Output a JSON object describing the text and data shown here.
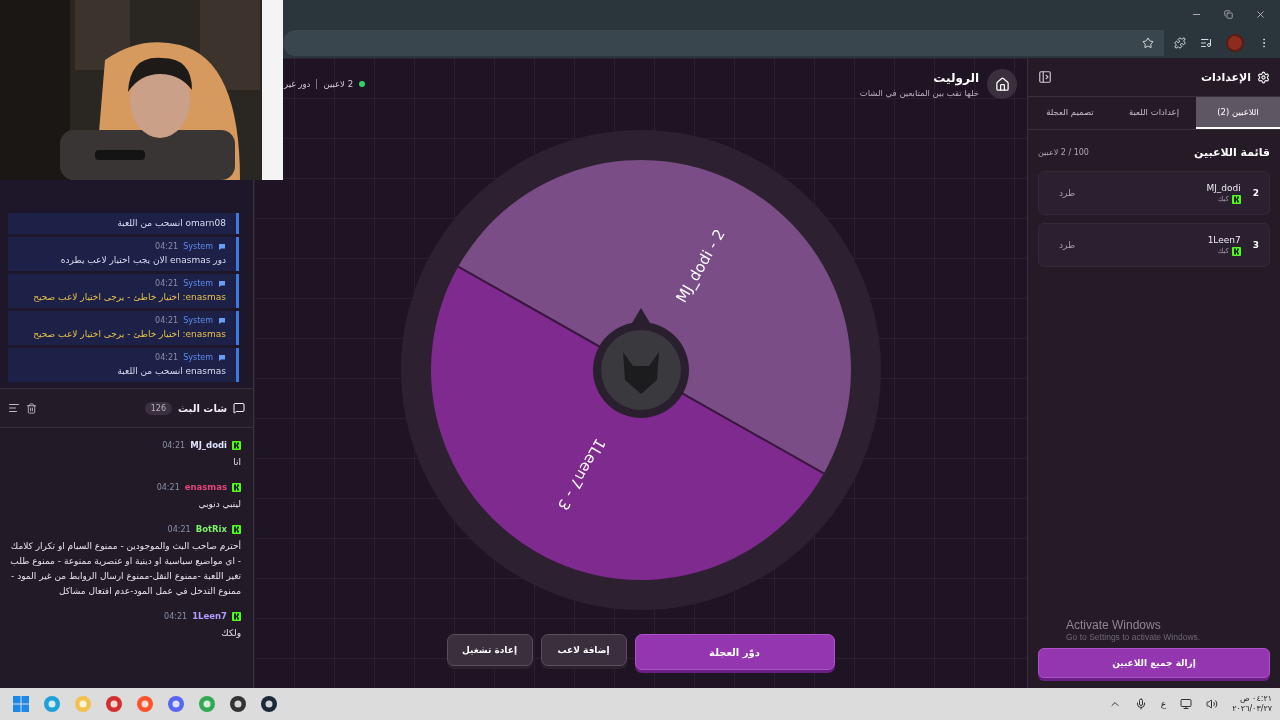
{
  "header": {
    "title": "الروليت",
    "subtitle": "خلها تقب بين المتابعين في الشات",
    "players_status": "2 لاعبين",
    "turn_status": "دور غير"
  },
  "stream_chat": {
    "system_messages": [
      {
        "text": "omarn08 انسحب من اللعبة",
        "warning": false
      },
      {
        "sender": "System",
        "time": "04:21",
        "text": "دور enasmas الان يجب اختيار لاعب يطرده",
        "warning": false
      },
      {
        "sender": "System",
        "time": "04:21",
        "text": "enasmas: اختيار خاطئ - يرجى اختيار لاعب صحيح",
        "warning": true
      },
      {
        "sender": "System",
        "time": "04:21",
        "text": "enasmas: اختيار خاطئ - يرجى اختيار لاعب صحيح",
        "warning": true
      },
      {
        "sender": "System",
        "time": "04:21",
        "text": "enasmas انسحب من اللعبة",
        "warning": false
      }
    ],
    "title": "شات البث",
    "count": "126",
    "messages": [
      {
        "user": "MJ_dodi",
        "time": "04:21",
        "text": "انا",
        "color": "#dfe3ff"
      },
      {
        "user": "enasmas",
        "time": "04:21",
        "text": "لينبي دنوبي",
        "color": "#e0457b"
      },
      {
        "user": "BotRix",
        "time": "04:21",
        "text": "أحترم صاحب البث والموجودين - ممنوع السبام او تكرار كلامك - اي مواضيع سياسية او دينية او عنصرية ممنوعة - ممنوع طلب تغير اللعبة -ممنوع النقل-ممنوع ارسال الروابط من غير المود - ممنوع التدخل في عمل المود-عدم افتعال مشاكل",
        "color": "#7cf26a"
      },
      {
        "user": "1Leen7",
        "time": "04:21",
        "text": "ولكك",
        "color": "#b49cff"
      }
    ]
  },
  "wheel": {
    "segments": [
      {
        "label": "MJ_dodi - 2",
        "color": "#7a4d86"
      },
      {
        "label": "1Leen7 - 3",
        "color": "#7e2a8e"
      }
    ]
  },
  "actions": [
    {
      "label": "دوّر العجلة",
      "kind": "primary"
    },
    {
      "label": "إضافة لاعب",
      "kind": "secondary"
    },
    {
      "label": "إعادة تشغيل",
      "kind": "secondary"
    }
  ],
  "settings": {
    "title": "الإعدادات",
    "tabs": [
      {
        "label": "اللاعبين (2)",
        "selected": true
      },
      {
        "label": "إعدادات اللعبة",
        "selected": false
      },
      {
        "label": "تصميم العجلة",
        "selected": false
      }
    ],
    "list_title": "قائمة اللاعبين",
    "list_count": "100 / 2 لاعبين",
    "players": [
      {
        "number": "2",
        "name": "MJ_dodi",
        "platform": "كيك",
        "action": "طرد"
      },
      {
        "number": "3",
        "name": "1Leen7",
        "platform": "كيك",
        "action": "طرد"
      }
    ],
    "notice": [
      "Activate Windows",
      "Go to Settings to activate Windows."
    ],
    "clear_button": "إزالة جميع اللاعبين"
  },
  "taskbar": {
    "keyboard": "ع",
    "time": "٠٤:٢١ ص",
    "date": "٢٠٢٦/٠٣/٢٧"
  }
}
